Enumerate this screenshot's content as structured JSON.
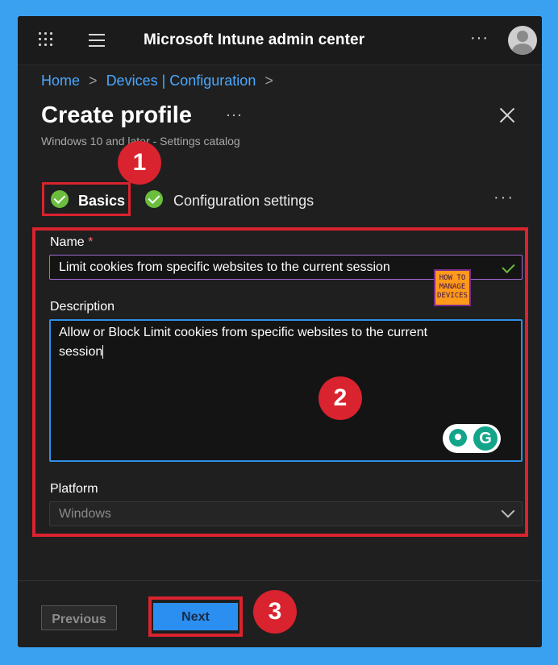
{
  "header": {
    "app_title": "Microsoft Intune admin center",
    "more_label": "···"
  },
  "breadcrumb": {
    "items": [
      "Home",
      "Devices | Configuration"
    ],
    "separator": ">"
  },
  "page": {
    "title": "Create profile",
    "title_more": "···",
    "subtitle": "Windows 10 and later - Settings catalog"
  },
  "steps": {
    "items": [
      {
        "label": "Basics",
        "status": "complete",
        "active": true
      },
      {
        "label": "Configuration settings",
        "status": "complete",
        "active": false
      }
    ],
    "more_label": "···"
  },
  "form": {
    "name": {
      "label": "Name",
      "required_marker": "*",
      "value": "Limit cookies from specific websites to the current session"
    },
    "description": {
      "label": "Description",
      "value_lines": [
        "Allow or Block Limit cookies from specific websites to the current",
        "session"
      ]
    },
    "platform": {
      "label": "Platform",
      "value": "Windows"
    }
  },
  "footer": {
    "previous_label": "Previous",
    "next_label": "Next"
  },
  "callouts": [
    "1",
    "2",
    "3"
  ],
  "watermark": {
    "lines": [
      "HOW TO",
      "MANAGE",
      "DEVICES"
    ]
  },
  "grammarly": {
    "letter": "G"
  },
  "colors": {
    "background": "#3aa0f0",
    "panel": "#1f1f1f",
    "link": "#4aa8ff",
    "accent": "#2a8ff0",
    "callout": "#d9232e",
    "check": "#6bbd3e"
  }
}
